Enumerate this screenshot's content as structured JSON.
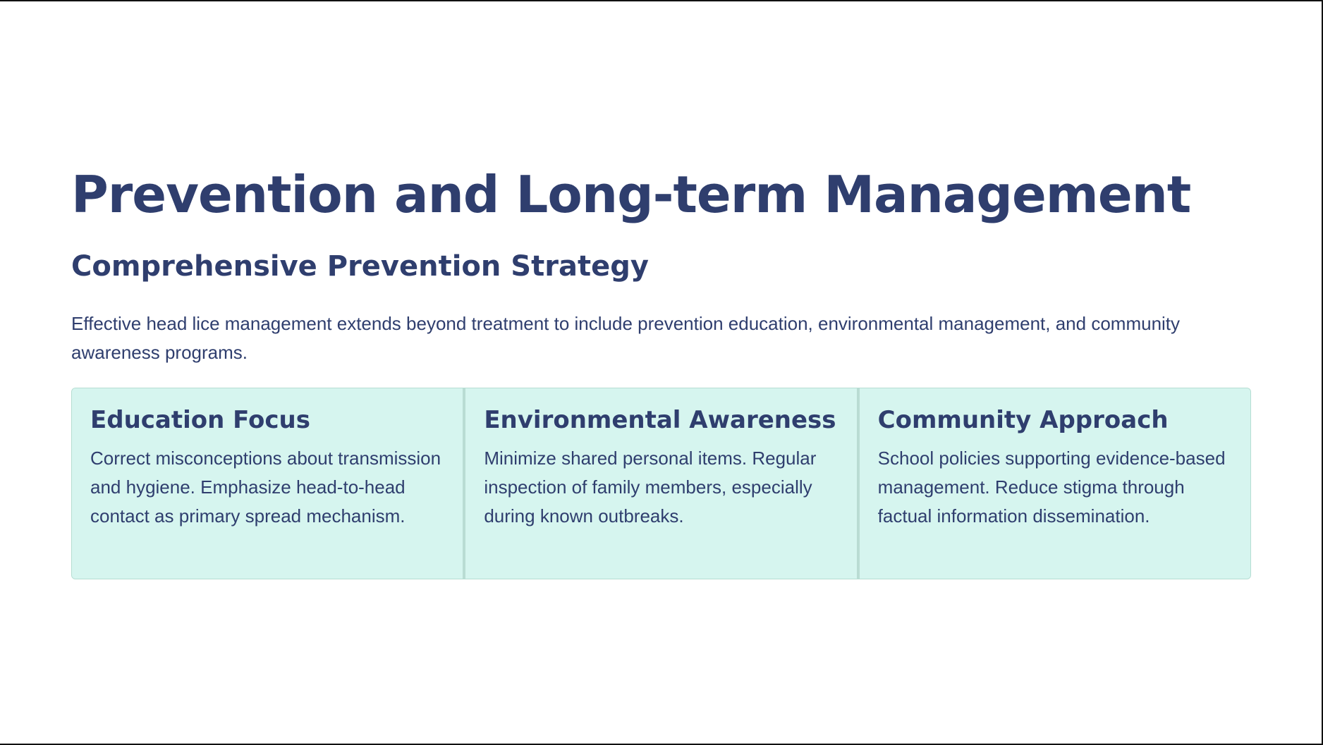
{
  "slide": {
    "title": "Prevention and Long-term Management",
    "subtitle": "Comprehensive Prevention Strategy",
    "intro": "Effective head lice management extends beyond treatment to include prevention education, environmental management, and community awareness programs."
  },
  "cards": [
    {
      "title": "Education Focus",
      "text": "Correct misconceptions about transmission and hygiene. Emphasize head-to-head contact as primary spread mechanism."
    },
    {
      "title": "Environmental Awareness",
      "text": "Minimize shared personal items. Regular inspection of family members, especially during known outbreaks."
    },
    {
      "title": "Community Approach",
      "text": "School policies supporting evidence-based management. Reduce stigma through factual information dissemination."
    }
  ],
  "colors": {
    "text": "#2f3e6e",
    "card_background": "#d6f5ef",
    "card_divider": "#b9dcd3",
    "background": "#ffffff"
  }
}
